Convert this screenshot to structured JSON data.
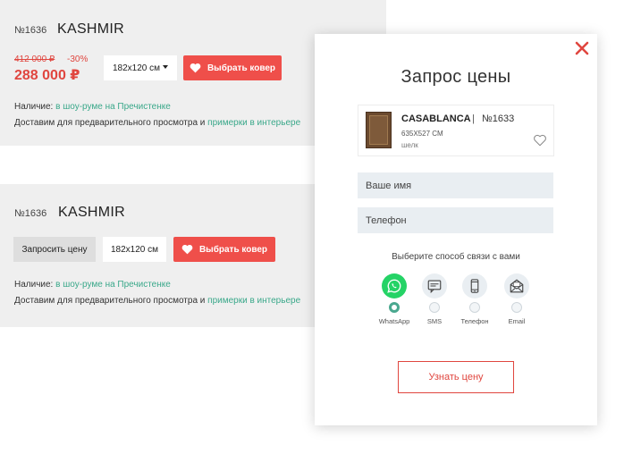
{
  "cards": [
    {
      "number": "№1636",
      "name": "KASHMIR",
      "old_price": "412 000 ₽",
      "discount": "-30%",
      "price": "288 000 ₽",
      "size": "182x120 см",
      "choose_label": "Выбрать ковер",
      "availability_label": "Наличие:",
      "availability_link": "в шоу-руме на Пречистенке",
      "delivery_text": "Доставим для предварительного просмотра и",
      "delivery_link": "примерки в интерьере"
    },
    {
      "number": "№1636",
      "name": "KASHMIR",
      "request_label": "Запросить цену",
      "size": "182x120 см",
      "choose_label": "Выбрать ковер",
      "availability_label": "Наличие:",
      "availability_link": "в шоу-руме на Пречистенке",
      "delivery_text": "Доставим для предварительного просмотра и",
      "delivery_link": "примерки в интерьере"
    }
  ],
  "modal": {
    "title": "Запрос цены",
    "product": {
      "name": "CASABLANCA",
      "separator": "|",
      "number": "№1633",
      "size": "635X527 СМ",
      "material": "шелк"
    },
    "name_placeholder": "Ваше имя",
    "phone_placeholder": "Телефон",
    "contact_prompt": "Выберите способ связи с вами",
    "contacts": [
      {
        "label": "WhatsApp",
        "icon": "whatsapp-icon",
        "selected": true
      },
      {
        "label": "SMS",
        "icon": "sms-icon",
        "selected": false
      },
      {
        "label": "Телефон",
        "icon": "phone-icon",
        "selected": false
      },
      {
        "label": "Email",
        "icon": "email-icon",
        "selected": false
      }
    ],
    "submit_label": "Узнать цену"
  },
  "colors": {
    "accent_red": "#ef4f4a",
    "link_green": "#3aa88a",
    "whatsapp_green": "#25d366"
  }
}
